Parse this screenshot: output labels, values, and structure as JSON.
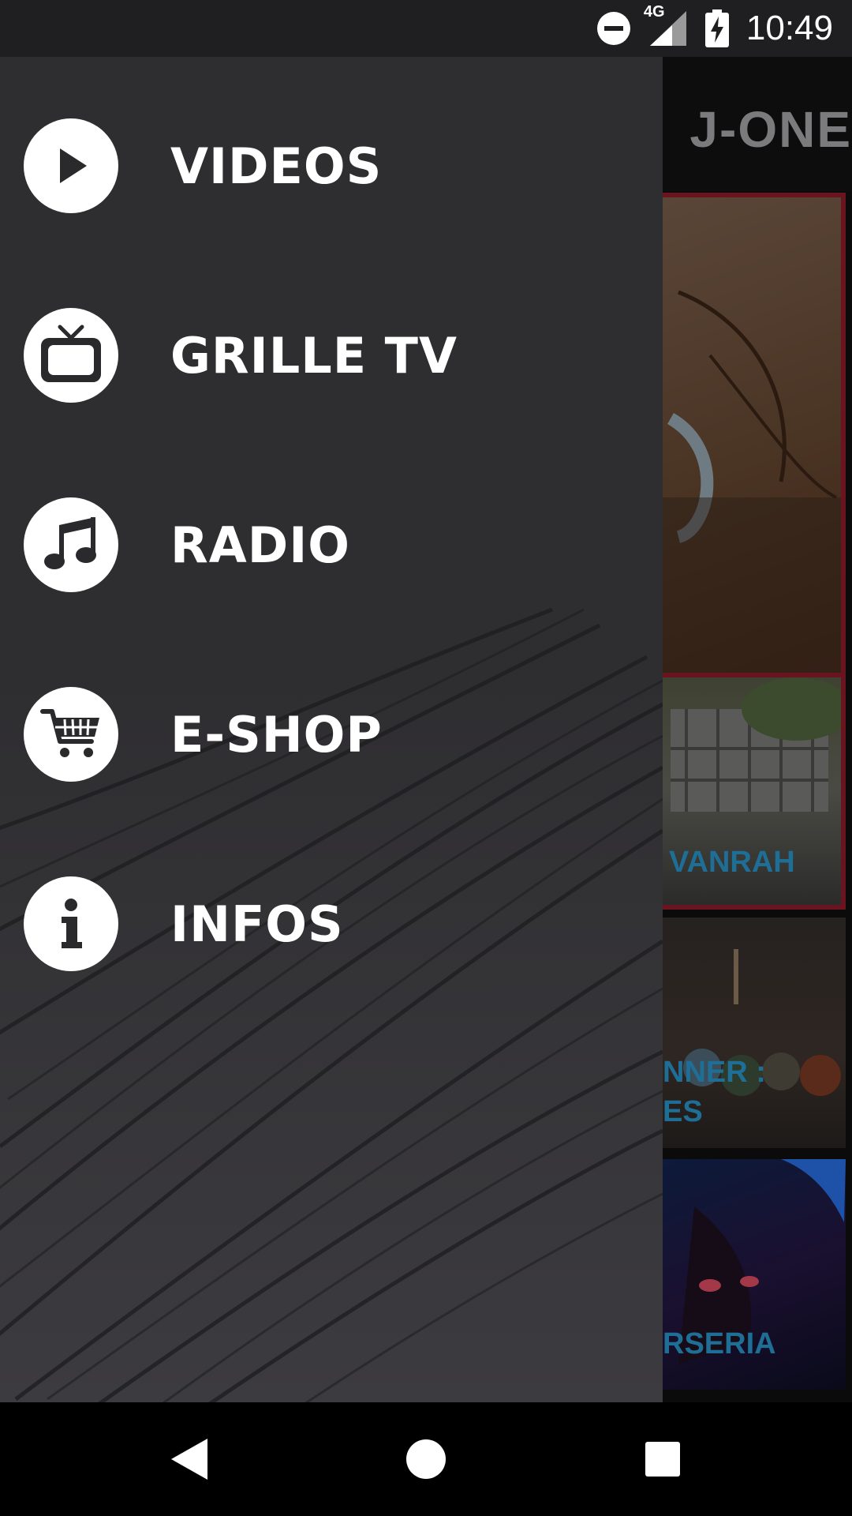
{
  "status_bar": {
    "time": "10:49",
    "network_type": "4G",
    "icons": [
      "do-not-disturb-icon",
      "signal-icon",
      "battery-charging-icon"
    ]
  },
  "app": {
    "logo_text": "J-ONE",
    "tiles": [
      {
        "label": ""
      },
      {
        "label": "VANRAH"
      },
      {
        "label_line1": "NNER :",
        "label_line2": "ES"
      },
      {
        "label": "RSERIA"
      }
    ]
  },
  "drawer": {
    "items": [
      {
        "label": "VIDEOS",
        "icon": "play-icon"
      },
      {
        "label": "GRILLE TV",
        "icon": "tv-icon"
      },
      {
        "label": "RADIO",
        "icon": "music-note-icon"
      },
      {
        "label": "E-SHOP",
        "icon": "cart-icon"
      },
      {
        "label": "INFOS",
        "icon": "info-icon"
      }
    ]
  },
  "system_nav": {
    "buttons": [
      "back-icon",
      "home-icon",
      "recents-icon"
    ]
  },
  "colors": {
    "drawer_bg": "#2e2d30",
    "status_bar_bg": "#1f1f21",
    "tile_text": "#1e6e96",
    "tile_border": "#6a1420"
  }
}
